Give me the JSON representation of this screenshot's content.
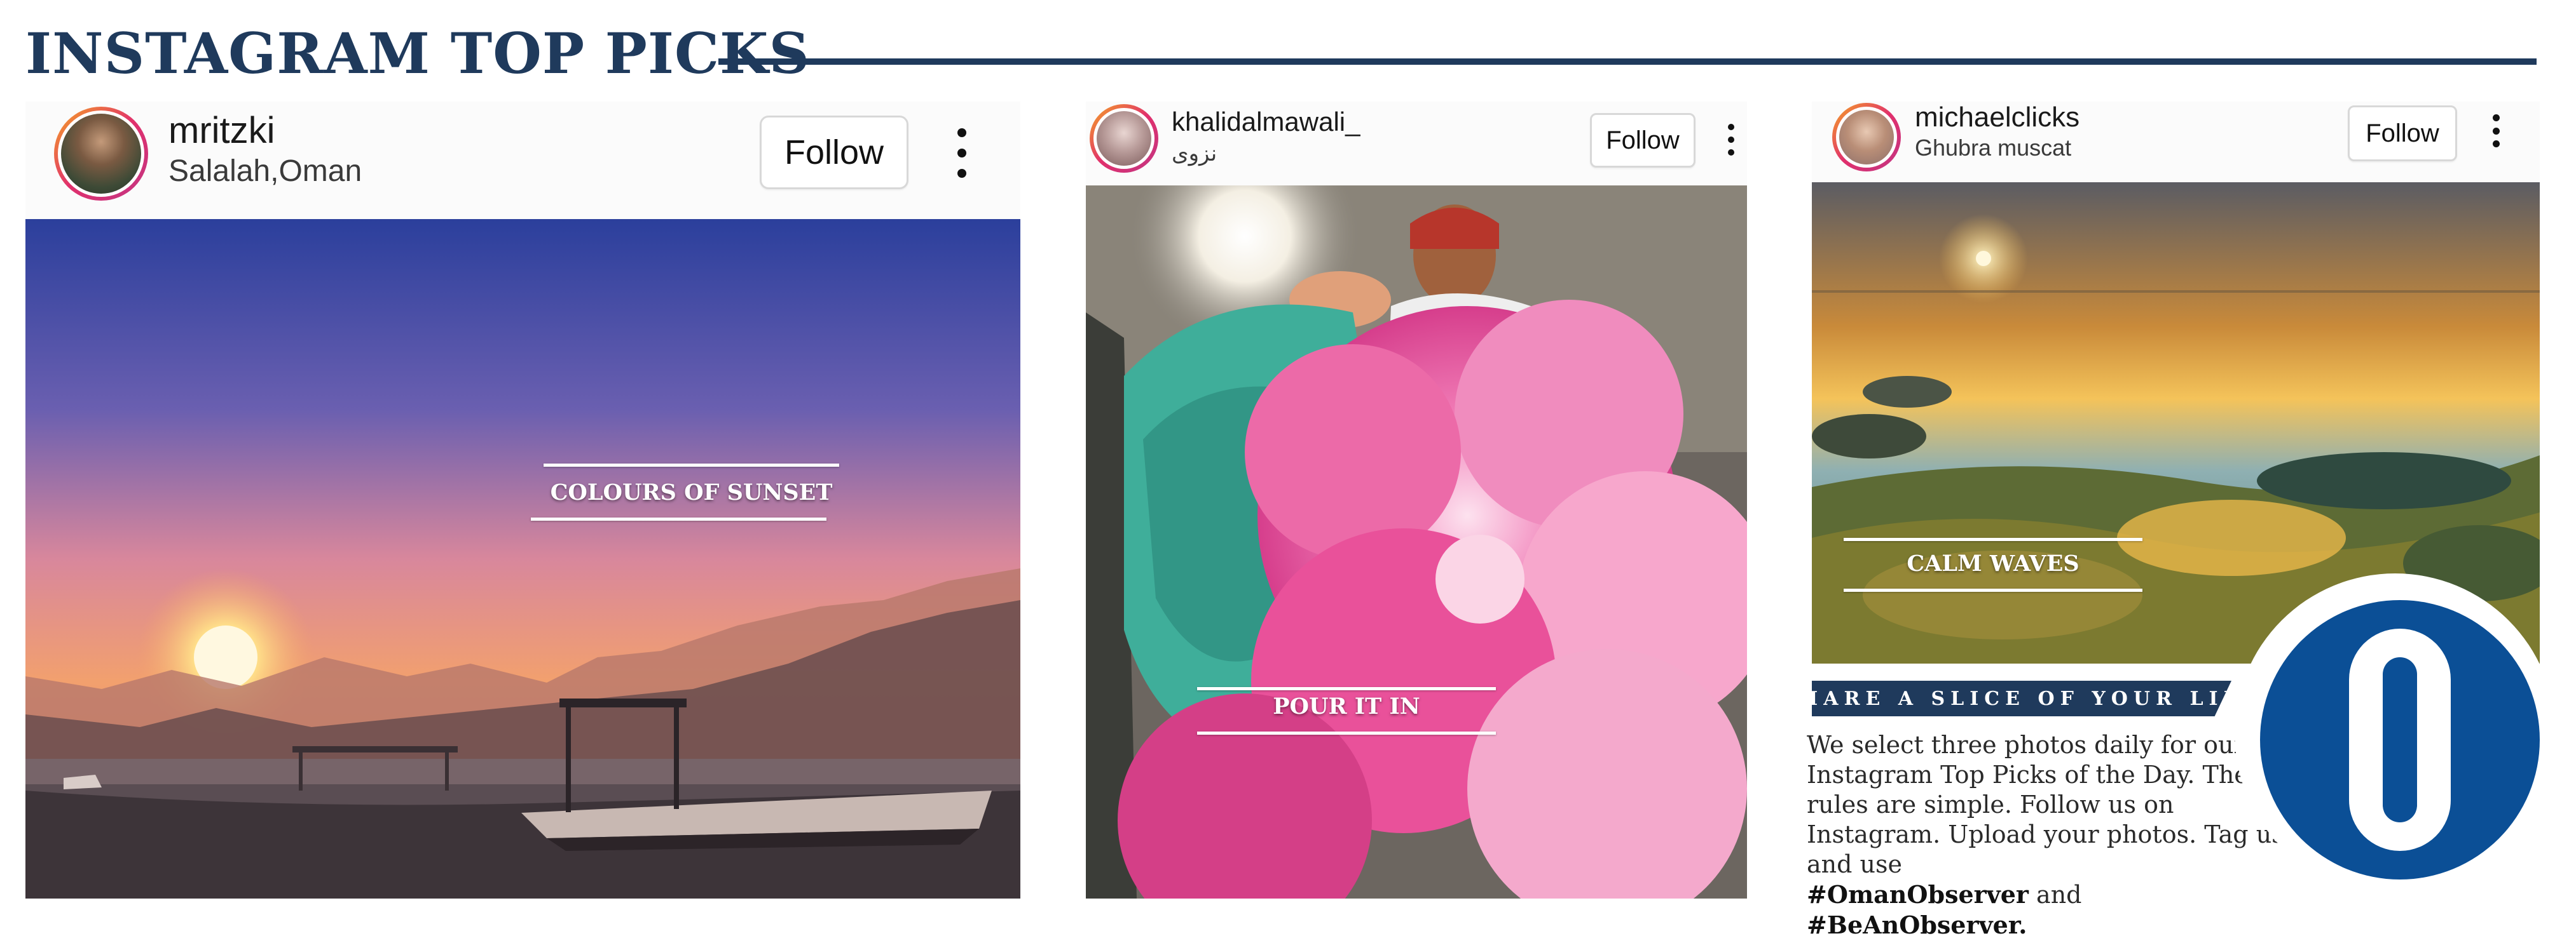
{
  "header": {
    "title": "INSTAGRAM TOP PICKS"
  },
  "posts": [
    {
      "username": "mritzki",
      "location": "Salalah,Oman",
      "follow_label": "Follow",
      "caption": "COLOURS OF SUNSET"
    },
    {
      "username": "khalidalmawali_",
      "location": "نزوى",
      "follow_label": "Follow",
      "caption": "POUR IT IN"
    },
    {
      "username": "michaelclicks",
      "location": "Ghubra muscat",
      "follow_label": "Follow",
      "caption": "CALM WAVES"
    }
  ],
  "promo": {
    "banner": "SHARE A SLICE OF YOUR LIFE",
    "text": "We select three photos daily for our Instagram Top Picks of the Day. The rules are simple. Follow us on Instagram. Upload your photos. Tag us and use",
    "hashtag1": "#OmanObserver",
    "connector": "and",
    "hashtag2": "#BeAnObserver."
  },
  "logo": {
    "letter": "O",
    "color": "#0b4f96"
  },
  "colors": {
    "navy": "#1f3a5c",
    "brand_blue": "#0b4f96"
  },
  "icons": [
    "avatar",
    "more-vertical-icon",
    "observer-logo-icon"
  ]
}
